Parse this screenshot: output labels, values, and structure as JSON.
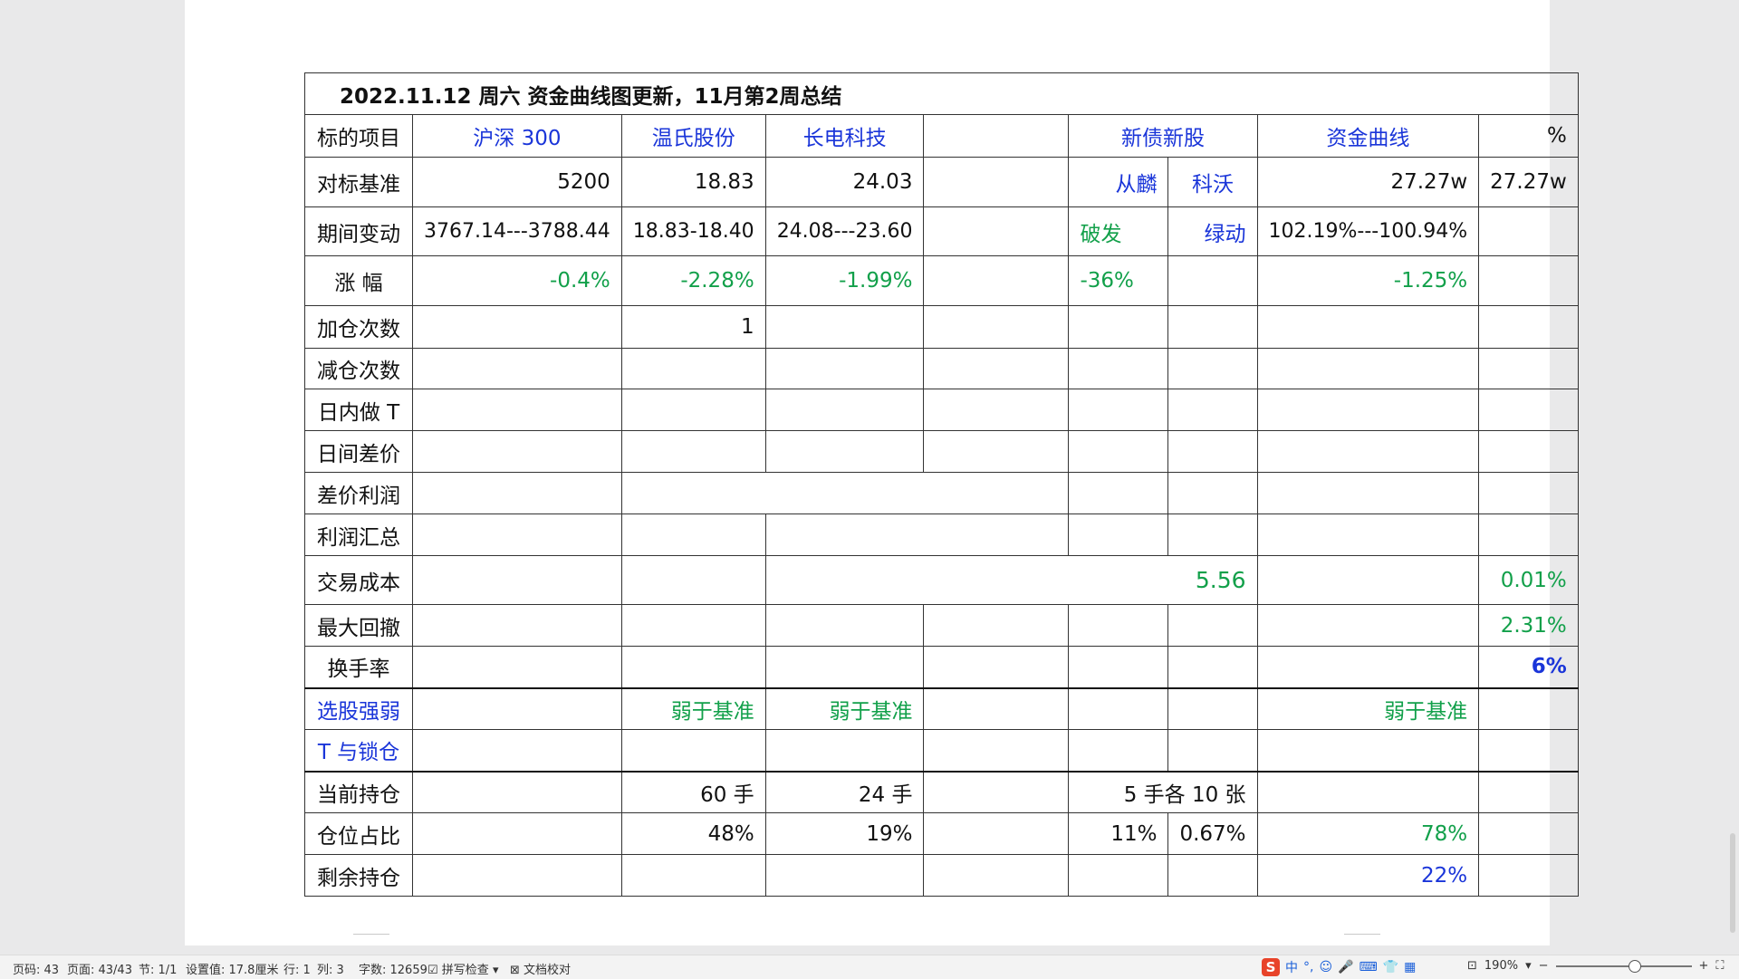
{
  "doc": {
    "title": "2022.11.12  周六  资金曲线图更新，11月第2周总结",
    "header": {
      "label": "标的项目",
      "c1": "沪深 300",
      "c2": "温氏股份",
      "c3": "长电科技",
      "c45": "新债新股",
      "c6": "资金曲线",
      "c7": "%"
    },
    "benchmark": {
      "label": "对标基准",
      "c1": "5200",
      "c2": "18.83",
      "c3": "24.03",
      "c4": "从麟",
      "c5": "科沃",
      "c6": "27.27w",
      "c7": "27.27w"
    },
    "change": {
      "label": "期间变动",
      "c1": "3767.14---3788.44",
      "c2": "18.83-18.40",
      "c3": "24.08---23.60",
      "c4": "破发",
      "c5": "绿动",
      "c6": "102.19%---100.94%"
    },
    "rise": {
      "label": "涨  幅",
      "c1": "-0.4%",
      "c2": "-2.28%",
      "c3": "-1.99%",
      "c4": "-36%",
      "c6": "-1.25%"
    },
    "add": {
      "label": "加仓次数",
      "c2": "1"
    },
    "reduce": {
      "label": "减仓次数"
    },
    "intraday": {
      "label": "日内做 T"
    },
    "interday": {
      "label": "日间差价"
    },
    "spread_profit": {
      "label": "差价利润"
    },
    "profit_total": {
      "label": "利润汇总"
    },
    "cost": {
      "label": "交易成本",
      "merged": "5.56",
      "c7": "0.01%"
    },
    "drawdown": {
      "label": "最大回撤",
      "c7": "2.31%"
    },
    "turnover": {
      "label": "换手率",
      "c7": "6%"
    },
    "selection": {
      "label": "选股强弱",
      "c2": "弱于基准",
      "c3": "弱于基准",
      "c6": "弱于基准"
    },
    "tlock": {
      "label": "T 与锁仓"
    },
    "holding": {
      "label": "当前持仓",
      "c2": "60 手",
      "c3": "24 手",
      "c45": "5 手各 10 张"
    },
    "ratio": {
      "label": "仓位占比",
      "c2": "48%",
      "c3": "19%",
      "c4": "11%",
      "c5": "0.67%",
      "c6": "78%"
    },
    "remain": {
      "label": "剩余持仓",
      "c6": "22%"
    }
  },
  "statusbar": {
    "page_code": "页码: 43",
    "pages": "页面: 43/43",
    "section": "节: 1/1",
    "setting": "设置值: 17.8厘米",
    "row": "行: 1",
    "col": "列: 3",
    "words": "字数: 12659",
    "spell": "拼写检查",
    "proof": "文档校对",
    "zoom": "190%",
    "ime_lang": "中"
  }
}
